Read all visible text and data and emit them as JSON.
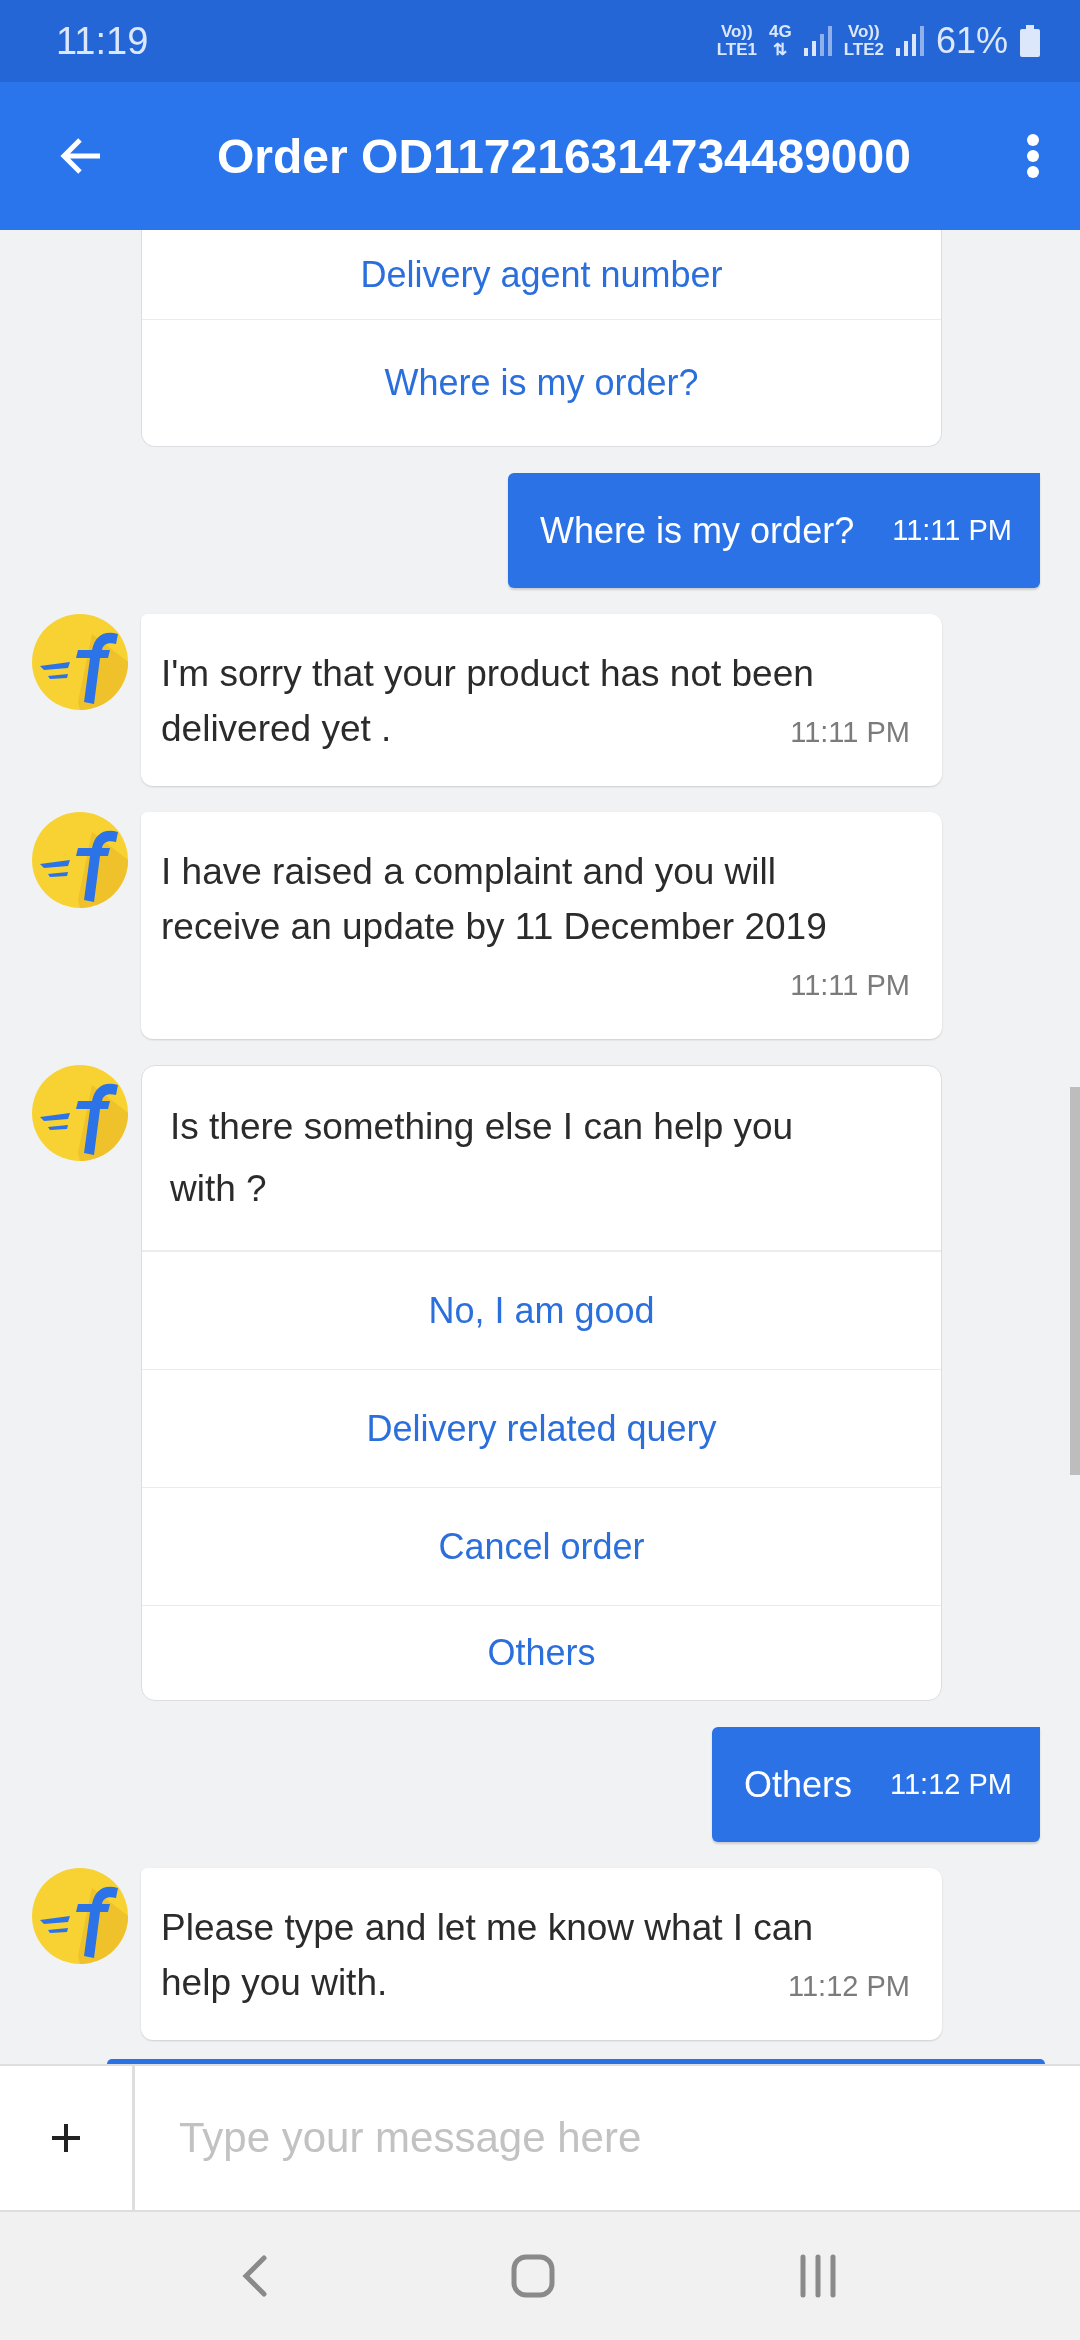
{
  "status_bar": {
    "time": "11:19",
    "volte1": "Vo))",
    "sim1": "LTE1",
    "network": "4G",
    "network_arrows": "⇅",
    "volte2": "Vo))",
    "sim2": "LTE2",
    "battery": "61%"
  },
  "header": {
    "title": "Order OD117216314734489000"
  },
  "messages": [
    {
      "kind": "options",
      "options": [
        "Delivery agent number",
        "Where is my order?"
      ]
    },
    {
      "kind": "user",
      "text": "Where is my order?",
      "time": "11:11 PM"
    },
    {
      "kind": "bot",
      "text": "I'm sorry that your product has not been delivered yet .",
      "time": "11:11 PM"
    },
    {
      "kind": "bot",
      "text": "I have raised a complaint and you will receive an update by 11 December 2019",
      "time": "11:11 PM"
    },
    {
      "kind": "question",
      "text": "Is there something else I can help you with ?",
      "options": [
        "No, I am good",
        "Delivery related query",
        "Cancel order",
        "Others"
      ]
    },
    {
      "kind": "user",
      "text": "Others",
      "time": "11:12 PM"
    },
    {
      "kind": "bot",
      "text": "Please type and let me know what I can help you with.",
      "time": "11:12 PM"
    },
    {
      "kind": "partial"
    }
  ],
  "composer": {
    "placeholder": "Type your message here"
  }
}
